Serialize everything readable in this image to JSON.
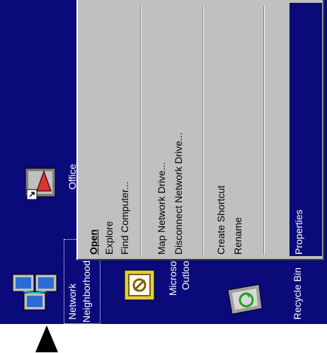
{
  "desktop": {
    "icons": [
      {
        "label_line1": "Network",
        "label_line2": "Neighborhood",
        "icon": "network-neighborhood-icon"
      },
      {
        "label_line1": "Office",
        "label_line2": "",
        "icon": "office-shortcut-icon"
      },
      {
        "label_line1": "Microsoft",
        "label_line2": "Outlook",
        "icon": "outlook-icon"
      },
      {
        "label_line1": "Recycle Bin",
        "label_line2": "",
        "icon": "recycle-bin-icon"
      }
    ]
  },
  "context_menu": {
    "groups": [
      [
        "Open",
        "Explore",
        "Find Computer..."
      ],
      [
        "Map Network Drive...",
        "Disconnect Network Drive..."
      ],
      [
        "Create Shortcut",
        "Rename"
      ],
      [
        "Properties"
      ]
    ],
    "default_item": "Open",
    "highlighted_item": "Properties"
  },
  "colors": {
    "desktop": "#0a0a7a",
    "menu": "#c0c0c0",
    "highlight": "#0a0a7a"
  }
}
